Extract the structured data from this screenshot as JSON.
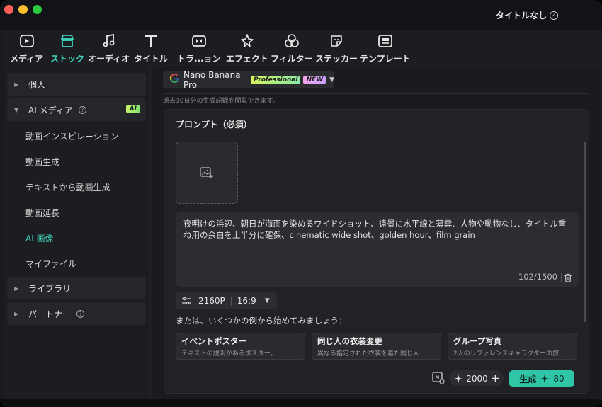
{
  "window": {
    "title": "タイトルなし"
  },
  "toolbar": {
    "items": [
      {
        "label": "メディア",
        "icon": "media-icon"
      },
      {
        "label": "ストック",
        "icon": "stock-store-icon",
        "active": true
      },
      {
        "label": "オーディオ",
        "icon": "music-note-icon"
      },
      {
        "label": "タイトル",
        "icon": "title-t-icon"
      },
      {
        "label": "トラ...ョン",
        "icon": "transition-icon"
      },
      {
        "label": "エフェクト",
        "icon": "effects-sparkle-icon"
      },
      {
        "label": "フィルター",
        "icon": "filter-icon"
      },
      {
        "label": "ステッカー",
        "icon": "sticker-icon"
      },
      {
        "label": "テンプレート",
        "icon": "template-icon"
      }
    ]
  },
  "sidebar": {
    "personal": "個人",
    "ai_media": "AI メディア",
    "ai_badge": "AI",
    "items": [
      "動画インスピレーション",
      "動画生成",
      "テキストから動画生成",
      "動画延長",
      "AI 画像",
      "マイファイル"
    ],
    "active_item": "AI 画像",
    "library": "ライブラリ",
    "partner": "パートナー"
  },
  "model": {
    "name": "Nano Banana Pro",
    "badge_pro": "Professional",
    "badge_new": "NEW"
  },
  "history_note": "過去30日分の生成記録を閲覧できます。",
  "prompt": {
    "title": "プロンプト（必須）",
    "text": "夜明けの浜辺、朝日が海面を染めるワイドショット、遠景に水平線と薄雲、人物や動物なし、タイトル重ね用の余白を上半分に確保、cinematic wide shot、golden hour、film grain",
    "counter": "102/1500"
  },
  "settings": {
    "resolution": "2160P",
    "ratio": "16:9"
  },
  "examples": {
    "hint": "または、いくつかの例から始めてみましょう：",
    "cards": [
      {
        "title": "イベントポスター",
        "desc": "テキストの説明があるポスター。"
      },
      {
        "title": "同じ人の衣装変更",
        "desc": "異なる指定された衣装を着た同じ人..."
      },
      {
        "title": "グループ写真",
        "desc": "2人のリファレンスキャラクターの旅..."
      }
    ]
  },
  "footer": {
    "credits": "2000",
    "generate_label": "生成",
    "generate_cost": "80"
  },
  "colors": {
    "accent": "#3fd7bd",
    "generate_button": "#2fc5a7",
    "background": "#1a1b1e"
  }
}
